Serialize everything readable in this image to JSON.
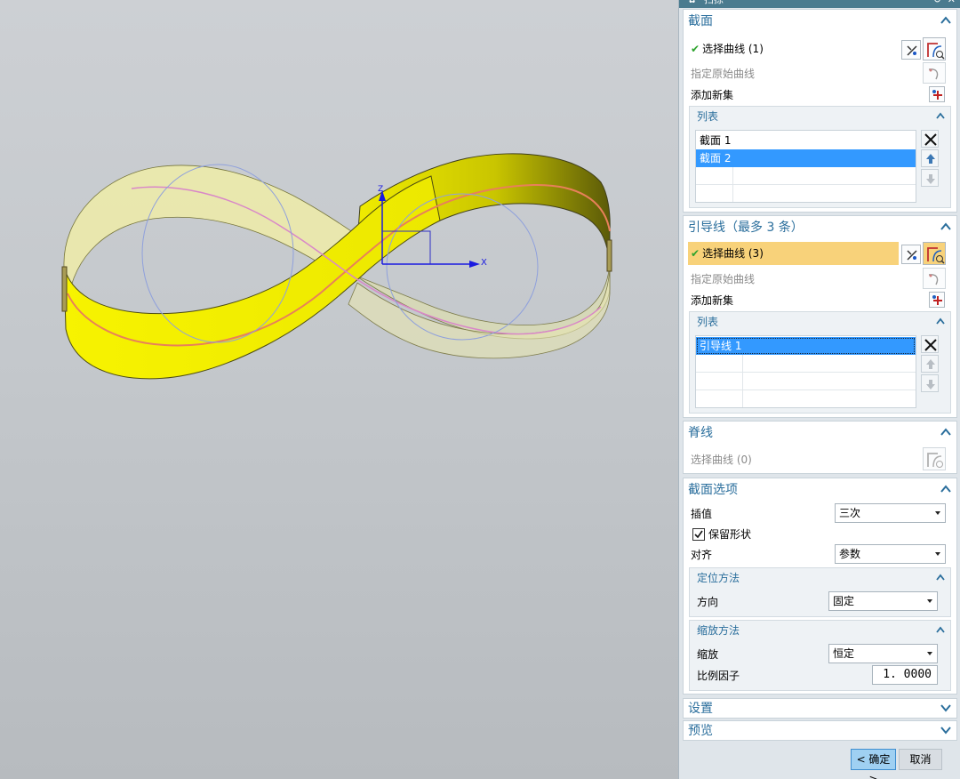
{
  "dialog": {
    "title": "扫掠",
    "section_section": {
      "title": "截面",
      "select_curve": "选择曲线 (1)",
      "specify_origin": "指定原始曲线",
      "add_new_set": "添加新集",
      "list_title": "列表",
      "list_items": [
        "截面 1",
        "截面 2"
      ],
      "selected_index": 1
    },
    "section_guides": {
      "title": "引导线（最多 3 条）",
      "select_curve": "选择曲线 (3)",
      "specify_origin": "指定原始曲线",
      "add_new_set": "添加新集",
      "list_title": "列表",
      "list_items": [
        "引导线 1"
      ]
    },
    "section_spine": {
      "title": "脊线",
      "select_curve": "选择曲线 (0)"
    },
    "section_options": {
      "title": "截面选项",
      "interp_label": "插值",
      "interp_value": "三次",
      "keep_shape_label": "保留形状",
      "keep_shape_checked": true,
      "align_label": "对齐",
      "align_value": "参数",
      "orient_title": "定位方法",
      "orient_label": "方向",
      "orient_value": "固定",
      "scale_title": "缩放方法",
      "scale_label": "缩放",
      "scale_value": "恒定",
      "factor_label": "比例因子",
      "factor_value": "1. 0000"
    },
    "settings_title": "设置",
    "preview_title": "预览",
    "ok_label": "< 确定 >",
    "cancel_label": "取消"
  },
  "viewport": {
    "axis_x": "X",
    "axis_z": "Z"
  },
  "colors": {
    "accent": "#2a6e9c",
    "selection": "#3399ff",
    "active_row": "#f8d27a",
    "surface_yellow": "#f2ef00"
  }
}
